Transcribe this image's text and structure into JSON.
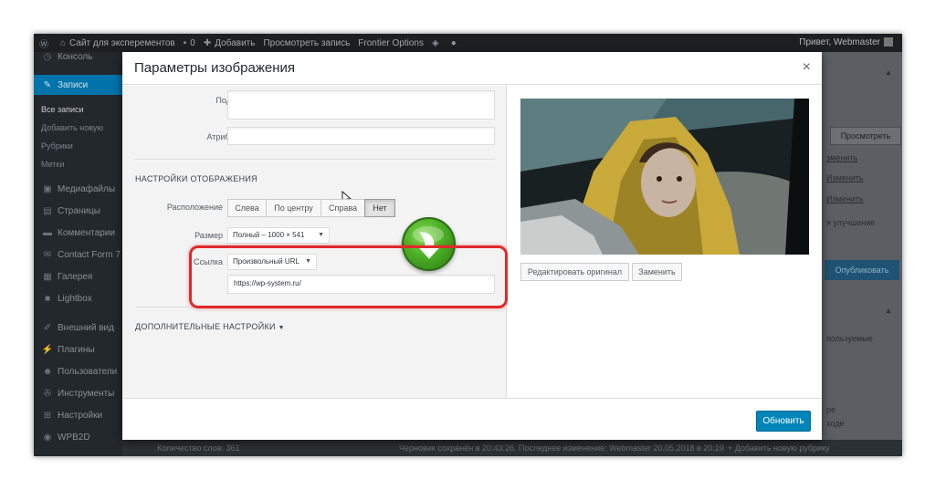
{
  "admin_bar": {
    "site_name": "Сайт для эксперементов",
    "comments_count": "0",
    "add_new": "Добавить",
    "view_post": "Просмотреть запись",
    "frontier": "Frontier Options",
    "greeting": "Привет, Webmaster"
  },
  "sidebar": {
    "items": [
      {
        "label": "Консоль",
        "icon": "dashboard-icon"
      },
      {
        "label": "Записи",
        "icon": "pin-icon"
      },
      {
        "label": "Медиафайлы",
        "icon": "media-icon"
      },
      {
        "label": "Страницы",
        "icon": "pages-icon"
      },
      {
        "label": "Комментарии",
        "icon": "comments-icon"
      },
      {
        "label": "Contact Form 7",
        "icon": "mail-icon"
      },
      {
        "label": "Галерея",
        "icon": "gallery-icon"
      },
      {
        "label": "Lightbox",
        "icon": "lightbox-icon"
      },
      {
        "label": "Внешний вид",
        "icon": "brush-icon"
      },
      {
        "label": "Плагины",
        "icon": "plugin-icon"
      },
      {
        "label": "Пользователи",
        "icon": "users-icon"
      },
      {
        "label": "Инструменты",
        "icon": "wrench-icon"
      },
      {
        "label": "Настройки",
        "icon": "settings-icon"
      },
      {
        "label": "WPB2D",
        "icon": "wpb2d-icon"
      }
    ],
    "submenu": [
      "Все записи",
      "Добавить новую",
      "Рубрики",
      "Метки"
    ]
  },
  "right_column": {
    "preview_button": "Просмотреть",
    "links": [
      "зменить",
      "Изменить",
      "Изменить"
    ],
    "improve": "я улучшение",
    "publish_button": "Опубликовать",
    "used": "пользуемые",
    "frag1": "ре",
    "frag2": "ходе",
    "add_category": "+ Добавить новую рубрику"
  },
  "editor_footer": {
    "word_count": "Количество слов: 361",
    "draft_status": "Черновик сохранён в 20:43:26. Последнее изменение: Webmaster 20.05.2018 в 20:19"
  },
  "modal": {
    "title": "Параметры изображения",
    "close_symbol": "×",
    "caption_label": "Подпись",
    "caption_value": "",
    "alt_label": "Атрибут alt",
    "alt_value": "",
    "display_section": "НАСТРОЙКИ ОТОБРАЖЕНИЯ",
    "align_label": "Расположение",
    "align_options": [
      "Слева",
      "По центру",
      "Справа",
      "Нет"
    ],
    "align_selected": "Нет",
    "size_label": "Размер",
    "size_value": "Полный – 1000 × 541",
    "link_label": "Ссылка",
    "link_type": "Произвольный URL",
    "link_url": "https://wp-system.ru/",
    "advanced": "ДОПОЛНИТЕЛЬНЫЕ НАСТРОЙКИ",
    "edit_original": "Редактировать оригинал",
    "replace": "Заменить",
    "update": "Обновить"
  },
  "colors": {
    "accent": "#0085ba",
    "highlight_box": "#e02a2a",
    "arrow_green": "#4caf25"
  }
}
